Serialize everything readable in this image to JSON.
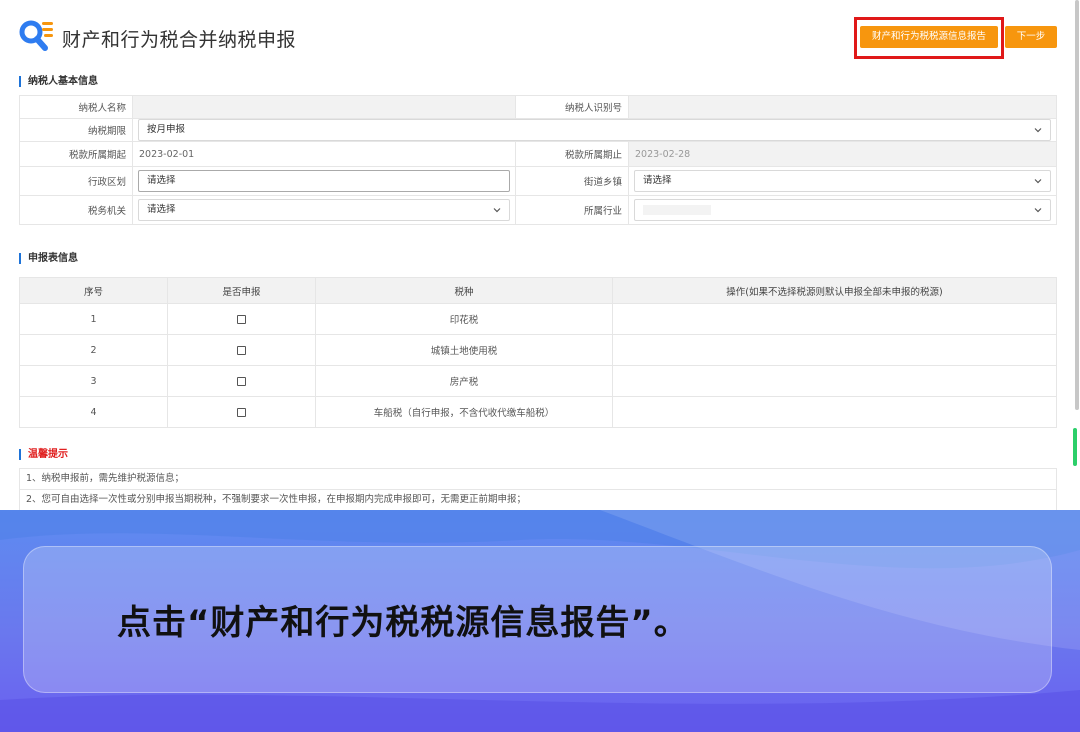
{
  "header": {
    "title": "财产和行为税合并纳税申报",
    "report_button": "财产和行为税税源信息报告",
    "next_button": "下一步"
  },
  "sections": {
    "taxpayer_info": "纳税人基本信息",
    "declaration": "申报表信息",
    "tips": "温馨提示"
  },
  "taxpayer": {
    "name_label": "纳税人名称",
    "id_label": "纳税人识别号",
    "period_label": "纳税期限",
    "period_value": "按月申报",
    "start_label": "税款所属期起",
    "start_value": "2023-02-01",
    "end_label": "税款所属期止",
    "end_value": "2023-02-28",
    "district_label": "行政区划",
    "district_value": "请选择",
    "street_label": "街道乡镇",
    "street_value": "请选择",
    "authority_label": "税务机关",
    "authority_value": "请选择",
    "industry_label": "所属行业"
  },
  "decl_table": {
    "headers": [
      "序号",
      "是否申报",
      "税种",
      "操作(如果不选择税源则默认申报全部未申报的税源)"
    ],
    "rows": [
      {
        "no": "1",
        "checked": false,
        "tax": "印花税"
      },
      {
        "no": "2",
        "checked": false,
        "tax": "城镇土地使用税"
      },
      {
        "no": "3",
        "checked": false,
        "tax": "房产税"
      },
      {
        "no": "4",
        "checked": false,
        "tax": "车船税（自行申报，不含代收代缴车船税）"
      }
    ]
  },
  "tips": [
    "1、纳税申报前，需先维护税源信息；",
    "2、您可自由选择一次性或分别申报当期税种，不强制要求一次性申报，在申报期内完成申报即可，无需更正前期申报；"
  ],
  "caption": "点击“财产和行为税税源信息报告”。",
  "colors": {
    "accent": "#f7960e",
    "highlight": "#e01818",
    "section_bar": "#1e73d8",
    "banner": "#6a78ee"
  }
}
